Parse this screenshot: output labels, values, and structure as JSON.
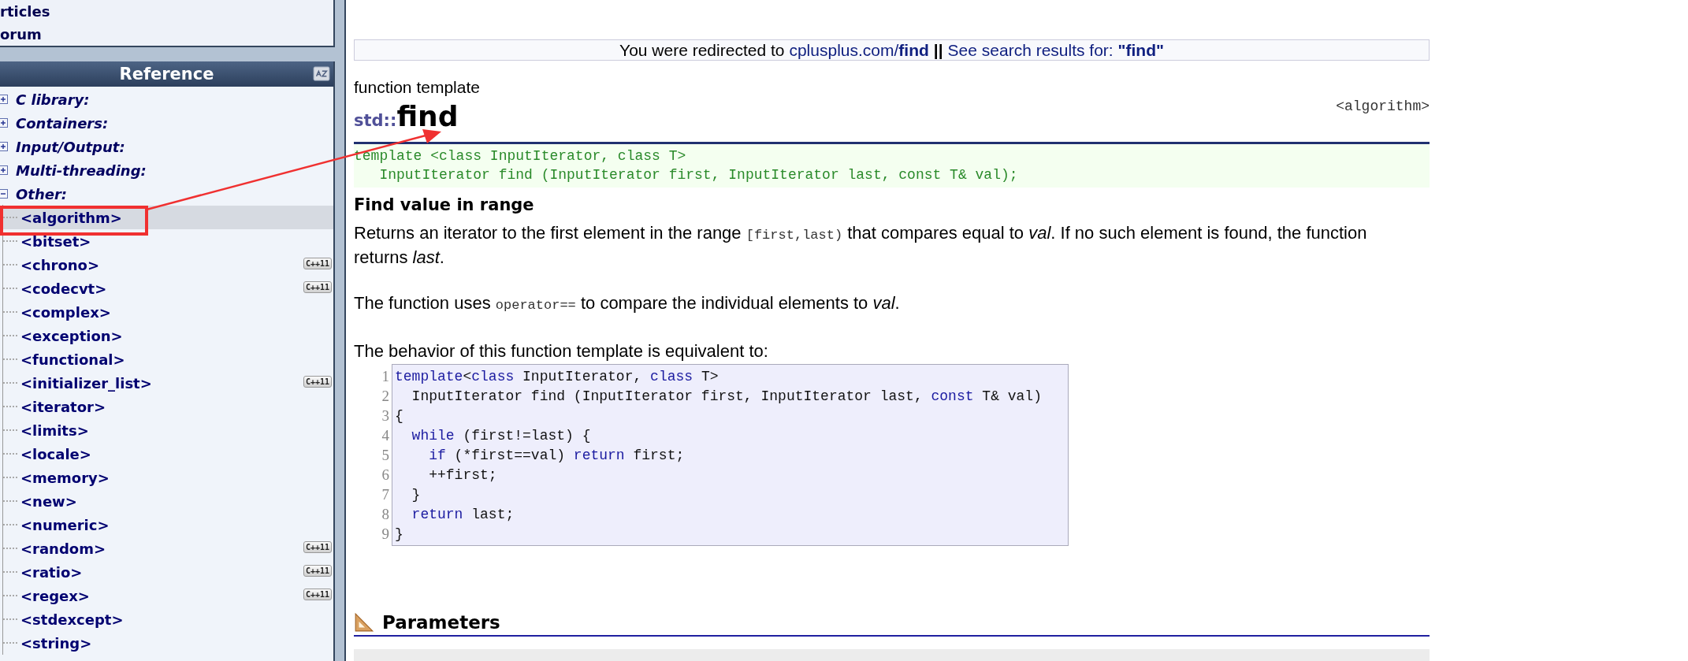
{
  "sidebar": {
    "links": [
      "rticles",
      "orum"
    ],
    "reference": {
      "title": "Reference",
      "items": [
        {
          "label": "C library:",
          "expanded": false
        },
        {
          "label": "Containers:",
          "expanded": false
        },
        {
          "label": "Input/Output:",
          "expanded": false
        },
        {
          "label": "Multi-threading:",
          "expanded": false
        },
        {
          "label": "Other:",
          "expanded": true,
          "children": [
            {
              "label": "<algorithm>",
              "selected": true
            },
            {
              "label": "<bitset>",
              "selected": false
            },
            {
              "label": "<chrono>",
              "selected": false,
              "badge": "C++11"
            },
            {
              "label": "<codecvt>",
              "selected": false,
              "badge": "C++11"
            },
            {
              "label": "<complex>",
              "selected": false
            },
            {
              "label": "<exception>",
              "selected": false
            },
            {
              "label": "<functional>",
              "selected": false
            },
            {
              "label": "<initializer_list>",
              "selected": false,
              "badge": "C++11"
            },
            {
              "label": "<iterator>",
              "selected": false
            },
            {
              "label": "<limits>",
              "selected": false
            },
            {
              "label": "<locale>",
              "selected": false
            },
            {
              "label": "<memory>",
              "selected": false
            },
            {
              "label": "<new>",
              "selected": false
            },
            {
              "label": "<numeric>",
              "selected": false
            },
            {
              "label": "<random>",
              "selected": false,
              "badge": "C++11"
            },
            {
              "label": "<ratio>",
              "selected": false,
              "badge": "C++11"
            },
            {
              "label": "<regex>",
              "selected": false,
              "badge": "C++11"
            },
            {
              "label": "<stdexcept>",
              "selected": false
            },
            {
              "label": "<string>",
              "selected": false
            }
          ]
        }
      ]
    }
  },
  "redirect": {
    "prefix": "You were redirected to",
    "link": "cplusplus.com/**find**",
    "separator": "||",
    "search_link": "See search results for: **\"find\"**"
  },
  "article": {
    "kind_label": "function template",
    "namespace": "std::",
    "name": "find",
    "header": "<algorithm>",
    "prototype": [
      "template <class InputIterator, class T>",
      "   InputIterator find (InputIterator first, InputIterator last, const T& val);"
    ],
    "summary": "Find value in range",
    "paragraphs": [
      [
        {
          "kind": "text",
          "text": "Returns an iterator to the first element in the range "
        },
        {
          "kind": "code",
          "text": "[first,last)"
        },
        {
          "kind": "text",
          "text": " that compares equal to *val*. If no such element is found, the function returns *last*."
        }
      ],
      [
        {
          "kind": "text",
          "text": "The function uses "
        },
        {
          "kind": "code",
          "text": "operator=="
        },
        {
          "kind": "text",
          "text": " to compare the individual elements to *val*."
        }
      ],
      [
        {
          "kind": "text",
          "text": "The behavior of this function template is equivalent to:"
        }
      ]
    ],
    "code": [
      {
        "number": "1",
        "tokens": [
          {
            "kind": "keyword",
            "text": "template"
          },
          {
            "kind": "plain",
            "text": "<"
          },
          {
            "kind": "keyword",
            "text": "class"
          },
          {
            "kind": "plain",
            "text": " InputIterator, "
          },
          {
            "kind": "keyword",
            "text": "class"
          },
          {
            "kind": "plain",
            "text": " T>"
          }
        ]
      },
      {
        "number": "2",
        "tokens": [
          {
            "kind": "plain",
            "text": "  InputIterator find (InputIterator first, InputIterator last, "
          },
          {
            "kind": "keyword",
            "text": "const"
          },
          {
            "kind": "plain",
            "text": " T& val)"
          }
        ]
      },
      {
        "number": "3",
        "tokens": [
          {
            "kind": "plain",
            "text": "{"
          }
        ]
      },
      {
        "number": "4",
        "tokens": [
          {
            "kind": "keyword",
            "text": "  while"
          },
          {
            "kind": "plain",
            "text": " (first!=last) {"
          }
        ]
      },
      {
        "number": "5",
        "tokens": [
          {
            "kind": "keyword",
            "text": "    if"
          },
          {
            "kind": "plain",
            "text": " (*first==val) "
          },
          {
            "kind": "keyword",
            "text": "return"
          },
          {
            "kind": "plain",
            "text": " first;"
          }
        ]
      },
      {
        "number": "6",
        "tokens": [
          {
            "kind": "plain",
            "text": "    ++first;"
          }
        ]
      },
      {
        "number": "7",
        "tokens": [
          {
            "kind": "plain",
            "text": "  }"
          }
        ]
      },
      {
        "number": "8",
        "tokens": [
          {
            "kind": "keyword",
            "text": "  return"
          },
          {
            "kind": "plain",
            "text": " last;"
          }
        ]
      },
      {
        "number": "9",
        "tokens": [
          {
            "kind": "plain",
            "text": "}"
          }
        ]
      }
    ],
    "section": "Parameters"
  }
}
